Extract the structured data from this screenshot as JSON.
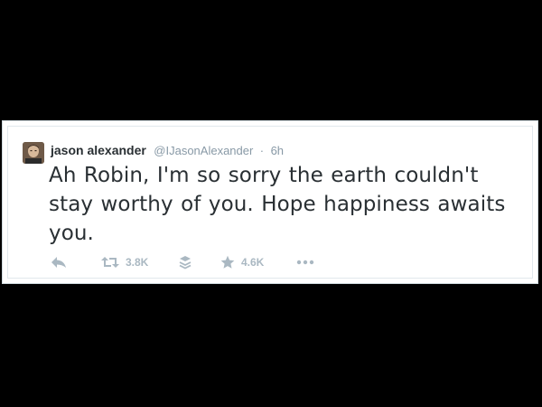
{
  "tweet": {
    "author": {
      "name": "jason alexander",
      "handle": "@IJasonAlexander"
    },
    "separator": "·",
    "time": "6h",
    "text": "Ah Robin, I'm so sorry the earth couldn't stay worthy of you. Hope happiness awaits you.",
    "actions": {
      "retweet_count": "3.8K",
      "favorite_count": "4.6K"
    }
  },
  "colors": {
    "background": "#000000",
    "card": "#ffffff",
    "text": "#292f33",
    "muted": "#8899a6",
    "icon": "#aab8c2"
  },
  "icons": {
    "reply": "reply-icon",
    "retweet": "retweet-icon",
    "buffer": "layers-icon",
    "favorite": "star-icon",
    "more": "more-dots-icon"
  }
}
